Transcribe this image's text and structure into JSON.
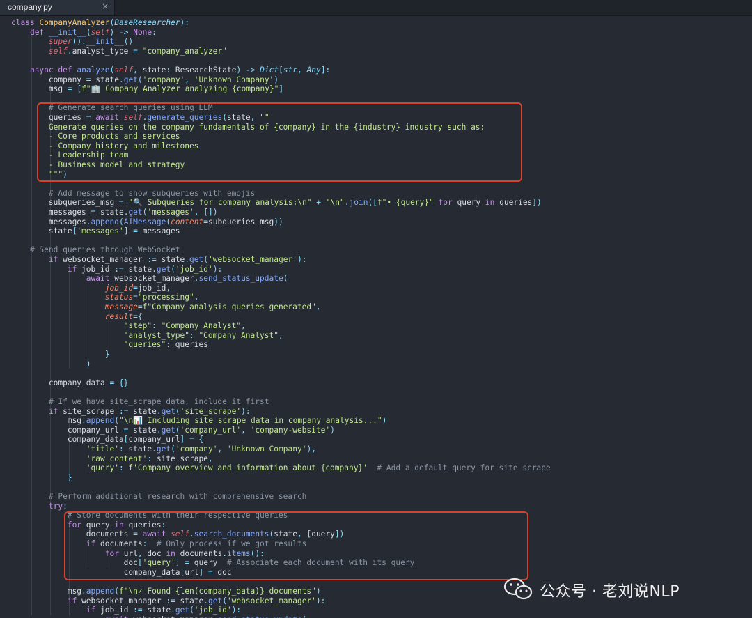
{
  "tab": {
    "filename": "company.py",
    "close_glyph": "×"
  },
  "code_lines": [
    "class CompanyAnalyzer(BaseResearcher):",
    "    def __init__(self) -> None:",
    "        super().__init__()",
    "        self.analyst_type = \"company_analyzer\"",
    "",
    "    async def analyze(self, state: ResearchState) -> Dict[str, Any]:",
    "        company = state.get('company', 'Unknown Company')",
    "        msg = [f\"🏢 Company Analyzer analyzing {company}\"]",
    "",
    "        # Generate search queries using LLM",
    "        queries = await self.generate_queries(state, \"\"\"",
    "        Generate queries on the company fundamentals of {company} in the {industry} industry such as:",
    "        - Core products and services",
    "        - Company history and milestones",
    "        - Leadership team",
    "        - Business model and strategy",
    "        \"\"\")",
    "",
    "        # Add message to show subqueries with emojis",
    "        subqueries_msg = \"🔍 Subqueries for company analysis:\\n\" + \"\\n\".join([f\"• {query}\" for query in queries])",
    "        messages = state.get('messages', [])",
    "        messages.append(AIMessage(content=subqueries_msg))",
    "        state['messages'] = messages",
    "",
    "    # Send queries through WebSocket",
    "        if websocket_manager := state.get('websocket_manager'):",
    "            if job_id := state.get('job_id'):",
    "                await websocket_manager.send_status_update(",
    "                    job_id=job_id,",
    "                    status=\"processing\",",
    "                    message=f\"Company analysis queries generated\",",
    "                    result={",
    "                        \"step\": \"Company Analyst\",",
    "                        \"analyst_type\": \"Company Analyst\",",
    "                        \"queries\": queries",
    "                    }",
    "                )",
    "",
    "        company_data = {}",
    "",
    "        # If we have site_scrape data, include it first",
    "        if site_scrape := state.get('site_scrape'):",
    "            msg.append(\"\\n📊 Including site scrape data in company analysis...\")",
    "            company_url = state.get('company_url', 'company-website')",
    "            company_data[company_url] = {",
    "                'title': state.get('company', 'Unknown Company'),",
    "                'raw_content': site_scrape,",
    "                'query': f'Company overview and information about {company}'  # Add a default query for site scrape",
    "            }",
    "",
    "        # Perform additional research with comprehensive search",
    "        try:",
    "            # Store documents with their respective queries",
    "            for query in queries:",
    "                documents = await self.search_documents(state, [query])",
    "                if documents:  # Only process if we got results",
    "                    for url, doc in documents.items():",
    "                        doc['query'] = query  # Associate each document with its query",
    "                        company_data[url] = doc",
    "",
    "            msg.append(f\"\\n✓ Found {len(company_data)} documents\")",
    "            if websocket_manager := state.get('websocket_manager'):",
    "                if job_id := state.get('job_id'):",
    "                    await websocket_manager.send_status_update("
  ],
  "watermark": {
    "text": "公众号 · 老刘说NLP"
  },
  "colors": {
    "background": "#252a33",
    "highlight_border": "#d8412a",
    "keyword": "#c792ea",
    "string": "#c3e88d",
    "comment": "#8b95a3",
    "function": "#82aaff",
    "class": "#ffcb6b"
  }
}
